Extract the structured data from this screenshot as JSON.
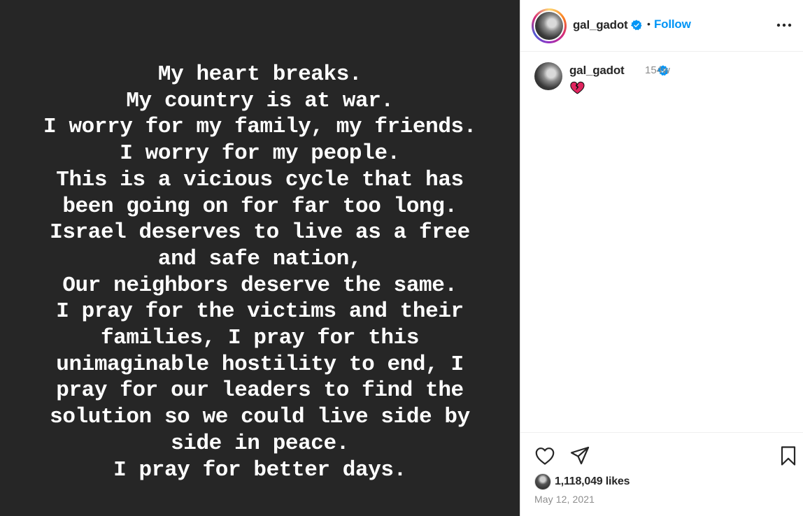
{
  "post": {
    "lines": [
      "My heart breaks.",
      "My country is at war.",
      "I worry for my family, my friends.",
      "I worry for my people.",
      "This is a vicious cycle that has",
      "been going on for far too long.",
      "Israel deserves to live as a free",
      "and safe nation,",
      "Our neighbors deserve the same.",
      "I pray for the victims and their",
      "families, I pray for this",
      "unimaginable hostility to end, I",
      "pray for our leaders to find the",
      "solution so we could live side by",
      "side in peace.",
      "I pray for better days."
    ]
  },
  "header": {
    "username": "gal_gadot",
    "separator": "•",
    "follow_label": "Follow"
  },
  "caption": {
    "username": "gal_gadot",
    "time": "154w",
    "emoji": "broken-heart-icon"
  },
  "footer": {
    "likes": "1,118,049 likes",
    "date": "May 12, 2021"
  },
  "colors": {
    "media_bg": "#262626",
    "accent": "#0095f6",
    "verified": "#0095f6",
    "muted_text": "#8e8e8e"
  },
  "icons": {
    "like": "heart-outline-icon",
    "share": "paper-plane-icon",
    "save": "bookmark-icon",
    "more": "more-options-icon",
    "verified": "verified-badge-icon"
  }
}
